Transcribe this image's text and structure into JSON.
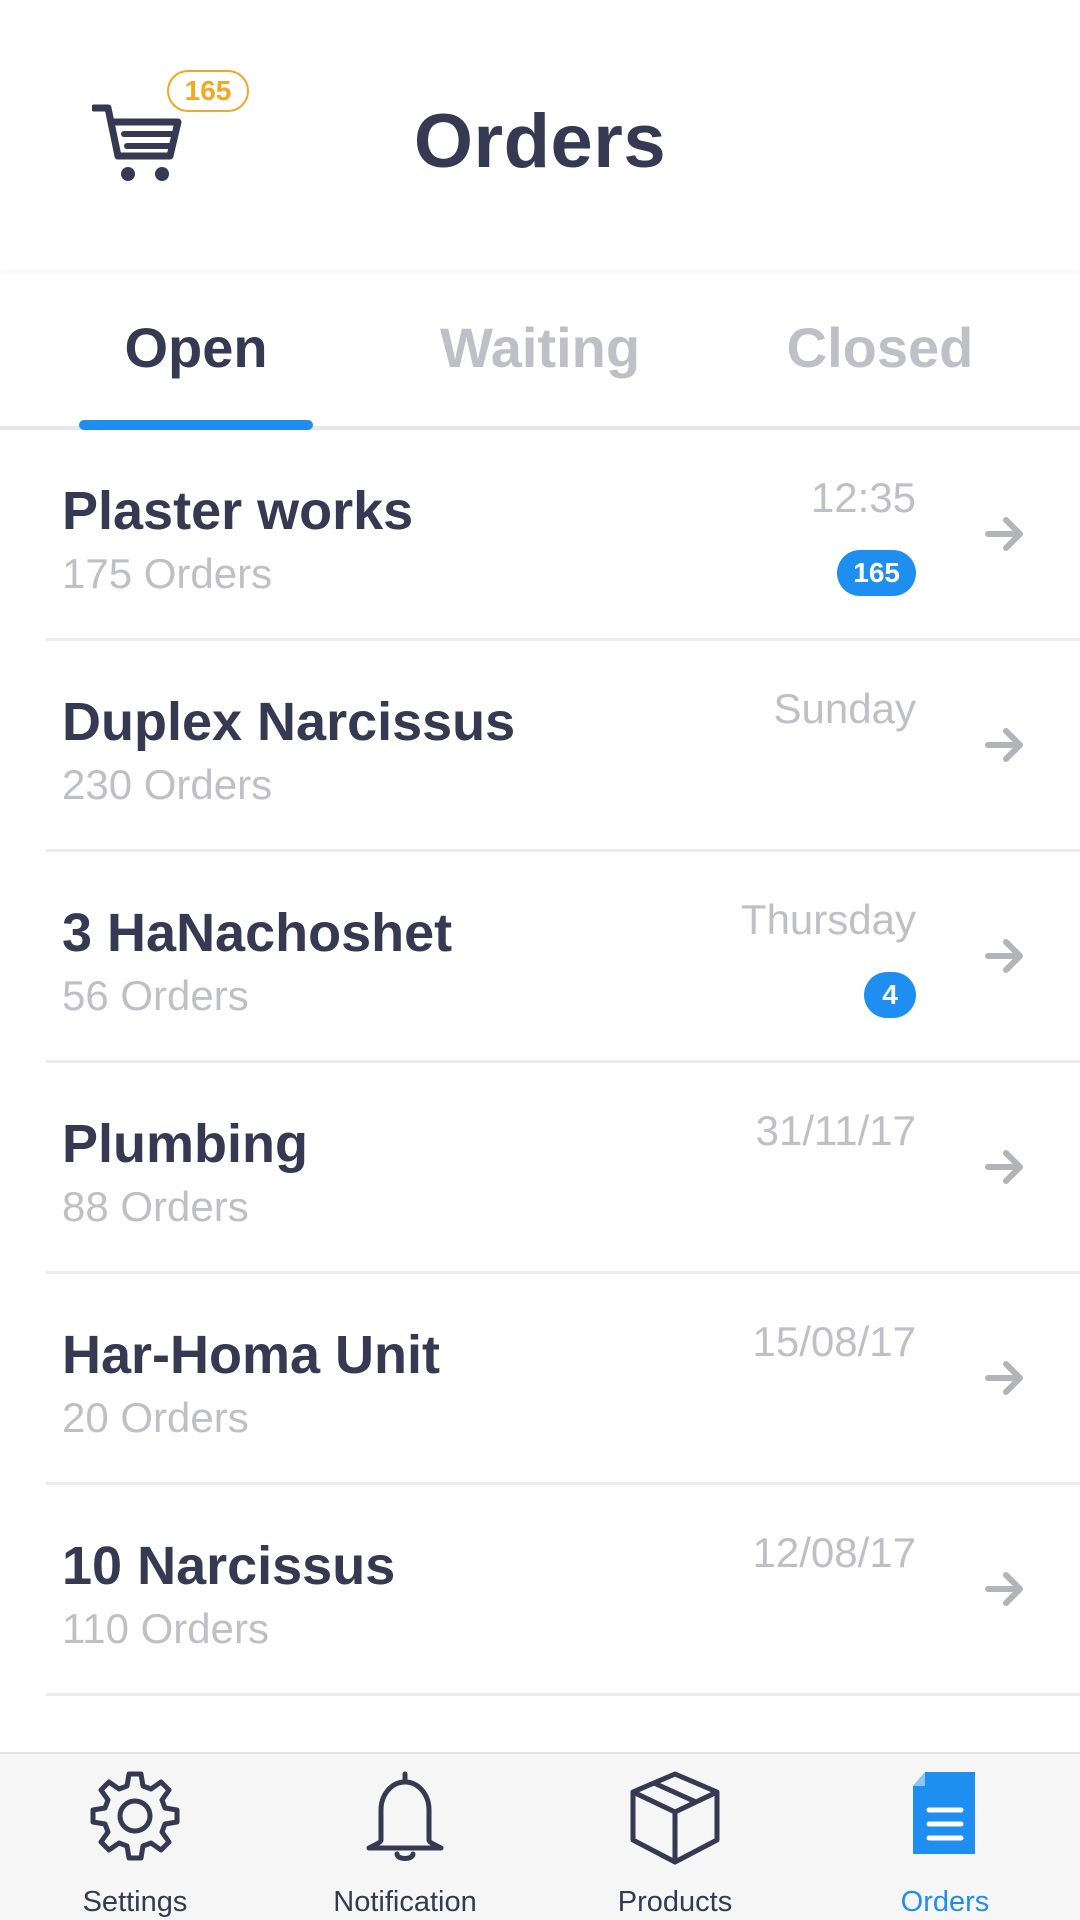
{
  "header": {
    "title": "Orders",
    "cart_count": "165",
    "cart_icon": "shopping-cart-icon"
  },
  "tabs": [
    {
      "label": "Open",
      "active": true
    },
    {
      "label": "Waiting",
      "active": false
    },
    {
      "label": "Closed",
      "active": false
    }
  ],
  "orders": [
    {
      "title": "Plaster works",
      "subtitle": "175 Orders",
      "time": "12:35",
      "badge": "165"
    },
    {
      "title": "Duplex Narcissus",
      "subtitle": "230 Orders",
      "time": "Sunday",
      "badge": null
    },
    {
      "title": "3 HaNachoshet",
      "subtitle": "56 Orders",
      "time": "Thursday",
      "badge": "4"
    },
    {
      "title": "Plumbing",
      "subtitle": "88 Orders",
      "time": "31/11/17",
      "badge": null
    },
    {
      "title": "Har-Homa Unit",
      "subtitle": "20 Orders",
      "time": "15/08/17",
      "badge": null
    },
    {
      "title": "10 Narcissus",
      "subtitle": "110 Orders",
      "time": "12/08/17",
      "badge": null
    }
  ],
  "bottom_nav": [
    {
      "label": "Settings",
      "icon": "gear-icon",
      "active": false
    },
    {
      "label": "Notification",
      "icon": "bell-icon",
      "active": false
    },
    {
      "label": "Products",
      "icon": "box-icon",
      "active": false
    },
    {
      "label": "Orders",
      "icon": "document-icon",
      "active": true
    }
  ],
  "colors": {
    "accent": "#1e8ff0",
    "badge_orange": "#f5a623",
    "text_dark": "#353a52",
    "text_muted": "#bfbfc8"
  }
}
